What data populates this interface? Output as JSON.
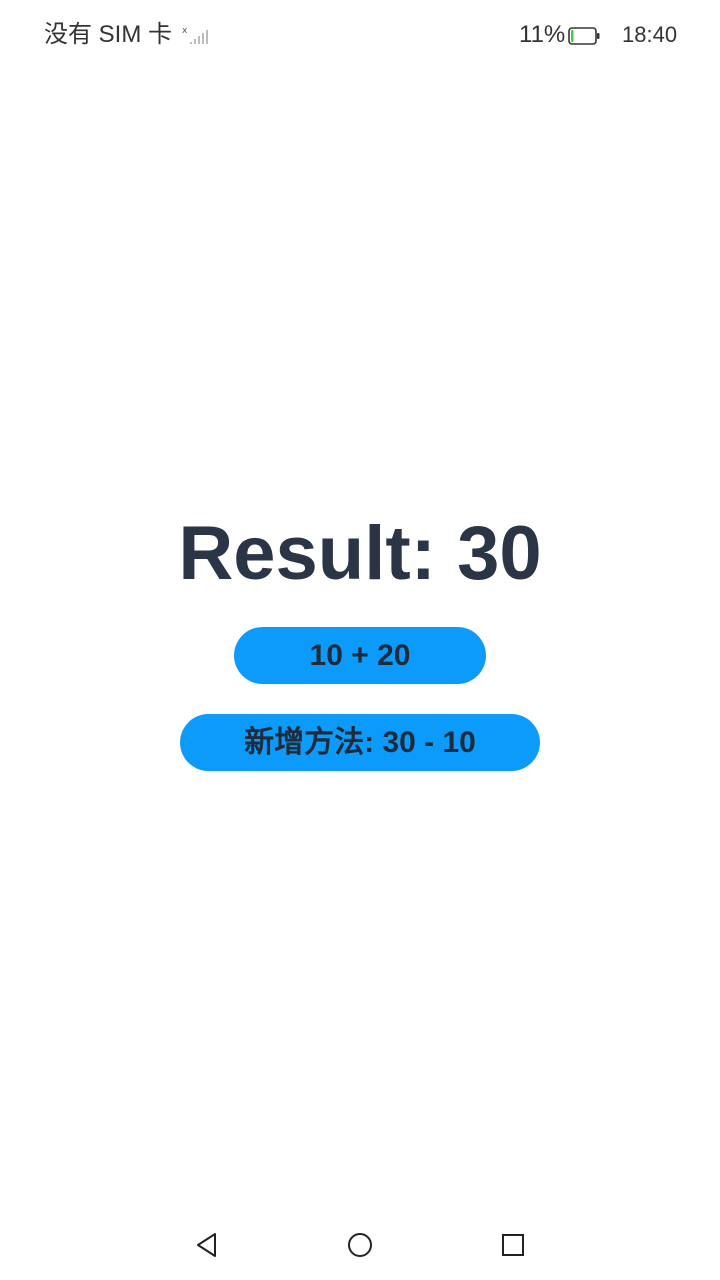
{
  "status_bar": {
    "carrier": "没有 SIM 卡",
    "battery_percent": "11%",
    "time": "18:40",
    "signal_icon": "no-signal-icon",
    "battery_icon": "battery-low-icon",
    "battery_level": 0.11
  },
  "main": {
    "result_text": "Result: 30",
    "add_button_label": "10 + 20",
    "sub_button_label": "新增方法: 30 - 10"
  },
  "colors": {
    "button_bg": "#0d9bfb",
    "result_text": "#2b3545",
    "button_text": "#1f2b3a",
    "battery_fill": "#3ccf4e"
  },
  "nav_bar": {
    "back_icon": "back-triangle-icon",
    "home_icon": "home-circle-icon",
    "recent_icon": "recent-apps-square-icon"
  }
}
